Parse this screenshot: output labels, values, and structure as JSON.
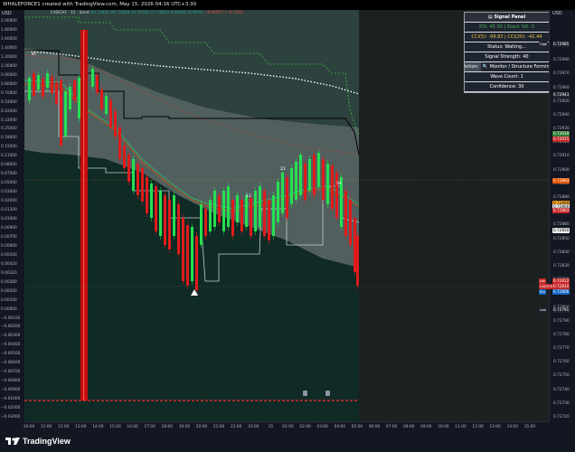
{
  "header": {
    "caption": "WHALEFORCE1 created with TradingView.com, May 15, 2026 04:16 UTC+3:30"
  },
  "legend": {
    "symbol": "CADCHF · 15 · Sand",
    "values": "O0.72850 H0.72859 L0.72785 C0.72810 0.00000 (0.00%)",
    "change": "−0.00077 (−0.11%)"
  },
  "axis_currency": {
    "left": "USD",
    "right": "USD"
  },
  "left_axis_ticks": [
    "2.00000",
    "1.80000",
    "1.60000",
    "1.40000",
    "1.20000",
    "1.00000",
    "0.90000",
    "0.80000",
    "0.70000",
    "0.54000",
    "0.42000",
    "0.33000",
    "0.25000",
    "0.18000",
    "0.15000",
    "0.11000",
    "0.08000",
    "0.07000",
    "0.05000",
    "0.03000",
    "0.02000",
    "0.01200",
    "0.01000",
    "0.00900",
    "0.00700",
    "0.00600",
    "0.00540",
    "0.00420",
    "0.00320",
    "0.00280",
    "0.00200",
    "0.00100",
    "0.00000",
    "−0.00100",
    "−0.00200",
    "−0.00300",
    "−0.00400",
    "−0.00500",
    "−0.00600",
    "−0.00700",
    "−0.00800",
    "−0.00900",
    "−0.01000",
    "−0.02000",
    "−0.03000"
  ],
  "right_axis_ticks": [
    "0.72990",
    "0.72980",
    "0.72970",
    "0.72960",
    "0.72950",
    "0.72940",
    "0.72930",
    "0.72920",
    "0.72910",
    "0.72900",
    "0.72890",
    "0.72880",
    "0.72870",
    "0.72860",
    "0.72850",
    "0.72840",
    "0.72830",
    "0.72820",
    "0.72810",
    "0.72800",
    "0.72790",
    "0.72780",
    "0.72770",
    "0.72760",
    "0.72750",
    "0.72740",
    "0.72730",
    "0.72720"
  ],
  "price_tags": [
    {
      "label": "High",
      "value": "0.72985",
      "color": "#1e2430"
    },
    {
      "label": "",
      "value": "0.72943",
      "color": "#1e2430"
    },
    {
      "label": "",
      "value": "0.72918",
      "color": "#2e7d32"
    },
    {
      "label": "",
      "value": "0.72915",
      "color": "#c62828"
    },
    {
      "label": "",
      "value": "0.72883",
      "color": "#e65100"
    },
    {
      "label": "",
      "value": "0.72869",
      "color": "#f9a825"
    },
    {
      "label": "",
      "value": "0.72866",
      "color": "#eeeeee"
    },
    {
      "label": "",
      "value": "0.72863",
      "color": "#c62828"
    },
    {
      "label": "",
      "value": "0.72850",
      "color": "#eeeeee"
    },
    {
      "label": "Ask",
      "value": "0.72812",
      "color": "#c62828"
    },
    {
      "label": "CADCHF",
      "value": "0.72810",
      "color": "#c62828"
    },
    {
      "label": "Bid",
      "value": "0.72806",
      "color": "#1565c0"
    },
    {
      "label": "Low",
      "value": "0.72791",
      "color": "#1e2430"
    }
  ],
  "time_labels": [
    "10:00",
    "11:00",
    "12:00",
    "13:00",
    "14:00",
    "15:00",
    "16:00",
    "17:00",
    "18:00",
    "19:00",
    "20:00",
    "21:00",
    "22:00",
    "23:00",
    "15",
    "01:00",
    "02:00",
    "03:00",
    "04:00",
    "05:00",
    "06:00",
    "07:00",
    "08:00",
    "09:00",
    "10:00",
    "11:00",
    "12:00",
    "13:00",
    "14:00",
    "15:00"
  ],
  "wave_labels": [
    "8?",
    "21",
    "13",
    "34"
  ],
  "signal_panel": {
    "title_icon": "clipboard-icon",
    "title": "Signal Panel",
    "rsi_stoch": "RSI: 45.00 | Stoch %K: 0",
    "cci": "CCI(5): -99.83 | CCI(20): -42.44",
    "status": "Status: Waiting...",
    "strength": "Signal Strength: 40",
    "action_label": "Action:",
    "action_icon": "magnifier-icon",
    "action_value": "Monitor / Structure Forming",
    "wave_count": "Wave Count: 1",
    "confidence": "Confidence: 30"
  },
  "branding": {
    "name": "TradingView"
  },
  "colors": {
    "up": "#26e051",
    "down": "#e01b1b",
    "panel_bg": "#1e2430"
  }
}
